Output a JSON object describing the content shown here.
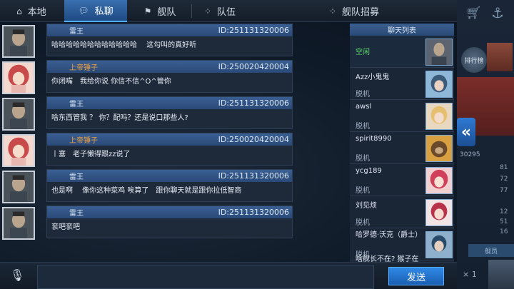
{
  "tabs": [
    {
      "label": "本地",
      "icon": "home-icon"
    },
    {
      "label": "私聊",
      "icon": "chat-bubble-icon"
    },
    {
      "label": "舰队",
      "icon": "fleet-icon"
    },
    {
      "label": "队伍",
      "icon": "team-icon"
    },
    {
      "label": "舰队招募",
      "icon": "recruit-icon"
    }
  ],
  "messages": [
    {
      "name": "雷王",
      "uid": "ID:251131320006",
      "text": "哈哈哈哈哈哈哈哈哈哈哈哈　 这勾叫的真好听",
      "name_color": "default",
      "avatar": "soldier"
    },
    {
      "name": "上帝锤子",
      "uid": "ID:250020420004",
      "text": "你闭嘴　我给你说 你信不信^O^管你",
      "name_color": "orange",
      "avatar": "anime-red"
    },
    {
      "name": "雷王",
      "uid": "ID:251131320006",
      "text": "啥东西管我 ？ 你？配吗？还是说口那些人?",
      "name_color": "default",
      "avatar": "soldier"
    },
    {
      "name": "上帝锤子",
      "uid": "ID:250020420004",
      "text": "丨塞　老子懒得跟zz说了",
      "name_color": "orange",
      "avatar": "anime-red"
    },
    {
      "name": "雷王",
      "uid": "ID:251131320006",
      "text": "也是啊　 像你这种菜鸡 唉算了　跟你聊天就是跟你拉低智商",
      "name_color": "default",
      "avatar": "soldier"
    },
    {
      "name": "雷王",
      "uid": "ID:251131320006",
      "text": "衮吧衮吧",
      "name_color": "default",
      "avatar": "soldier"
    }
  ],
  "chat_list": {
    "title": "聊天列表",
    "items": [
      {
        "name": "",
        "status": "空闲",
        "status_color": "green"
      },
      {
        "name": "Azz小鬼鬼",
        "status": "脱机"
      },
      {
        "name": "awsl",
        "status": "脱机"
      },
      {
        "name": "spirit8990",
        "status": "脱机"
      },
      {
        "name": "ycg189",
        "status": "脱机"
      },
      {
        "name": "刘见烦",
        "status": "脱机"
      },
      {
        "name": "哈罗德·沃克（爵士）",
        "status": "脱机"
      },
      {
        "name": "啥舰长不在? 猴子在",
        "status": ""
      }
    ]
  },
  "side_panel": {
    "rank_label": "排行榜",
    "id_fragment": "30295",
    "stats": [
      "81",
      "72",
      "77",
      "12",
      "51",
      "16"
    ],
    "dock_label": "舰员",
    "multiplier": "× 1"
  },
  "input": {
    "placeholder": "",
    "value": ""
  },
  "send_label": "发送",
  "colors": {
    "accent": "#2f89e6",
    "tab_active": "#3a6fb0",
    "online": "#5fdc6a",
    "name_highlight": "#f0a040"
  }
}
